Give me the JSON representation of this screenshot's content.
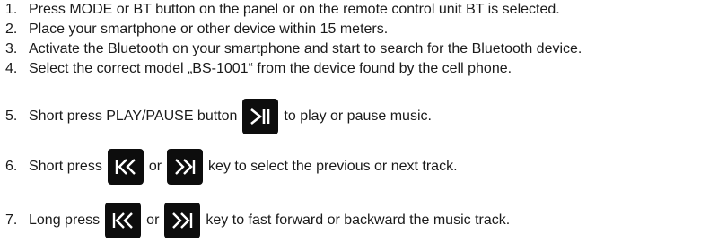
{
  "steps": [
    {
      "num": "1.",
      "text": "Press MODE or BT button on the panel or on the remote control unit BT is selected."
    },
    {
      "num": "2.",
      "text": "Place your smartphone or other device within 15 meters."
    },
    {
      "num": "3.",
      "text": "Activate the Bluetooth on your smartphone and start to search for the Bluetooth device."
    },
    {
      "num": "4.",
      "text": "Select the correct model „BS-1001“ from the device found by the cell phone."
    },
    {
      "num": "5.",
      "before": "Short press PLAY/PAUSE button",
      "after": "to play or pause music."
    },
    {
      "num": "6.",
      "before": "Short press",
      "mid": "or",
      "after": "key to select the previous or next track."
    },
    {
      "num": "7.",
      "before": "Long press",
      "mid": "or",
      "after": "key to fast forward or backward the music track."
    }
  ],
  "icons": {
    "play_pause": "play-pause-icon",
    "previous": "previous-track-icon",
    "next": "next-track-icon"
  },
  "colors": {
    "text": "#1a1a1a",
    "button_bg": "#0d0d0d",
    "button_glyph": "#ffffff"
  }
}
